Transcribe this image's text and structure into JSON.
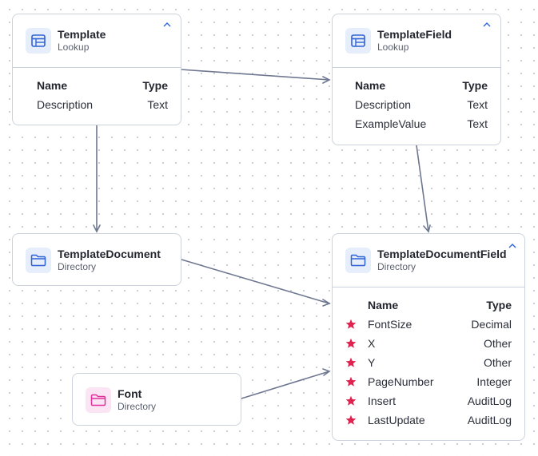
{
  "nodes": {
    "template": {
      "title": "Template",
      "subtitle": "Lookup",
      "col_name": "Name",
      "col_type": "Type",
      "fields": [
        {
          "name": "Description",
          "type": "Text"
        }
      ]
    },
    "template_field": {
      "title": "TemplateField",
      "subtitle": "Lookup",
      "col_name": "Name",
      "col_type": "Type",
      "fields": [
        {
          "name": "Description",
          "type": "Text"
        },
        {
          "name": "ExampleValue",
          "type": "Text"
        }
      ]
    },
    "template_document": {
      "title": "TemplateDocument",
      "subtitle": "Directory"
    },
    "template_document_field": {
      "title": "TemplateDocumentField",
      "subtitle": "Directory",
      "col_name": "Name",
      "col_type": "Type",
      "fields": [
        {
          "name": "FontSize",
          "type": "Decimal"
        },
        {
          "name": "X",
          "type": "Other"
        },
        {
          "name": "Y",
          "type": "Other"
        },
        {
          "name": "PageNumber",
          "type": "Integer"
        },
        {
          "name": "Insert",
          "type": "AuditLog"
        },
        {
          "name": "LastUpdate",
          "type": "AuditLog"
        }
      ]
    },
    "font": {
      "title": "Font",
      "subtitle": "Directory"
    }
  },
  "icons": {
    "lookup": "table-icon",
    "directory": "folder-icon",
    "required": "star-icon",
    "collapse": "chevron-up-icon"
  },
  "colors": {
    "edge": "#6f7891",
    "lookup_icon": "#2f63d6",
    "directory_icon": "#2f63d6",
    "font_icon": "#e0309c",
    "star": "#e0234e"
  }
}
